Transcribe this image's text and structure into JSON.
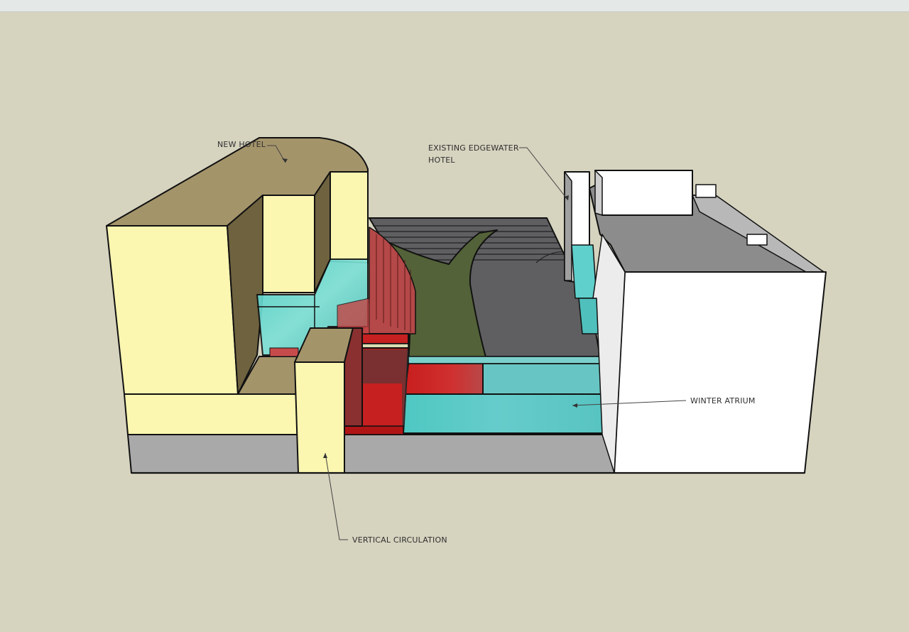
{
  "annotations": {
    "new_hotel": "NEW HOTEL",
    "existing_hotel_line1": "EXISTING EDGEWATER",
    "existing_hotel_line2": "HOTEL",
    "winter_atrium": "WINTER ATRIUM",
    "vertical_circulation": "VERTICAL CIRCULATION"
  },
  "colors": {
    "background": "#d6d3bf",
    "new_hotel_roof": "#a4946a",
    "new_hotel_wall": "#fbf6b0",
    "new_hotel_shade": "#6e623f",
    "glass": "#5fd6d0",
    "red_glazing": "#c62020",
    "green_roof": "#536238",
    "dark_deck": "#5f5f62",
    "podium": "#a9a9a9",
    "existing_hotel": "#ffffff",
    "existing_hotel_roof": "#8c8c8c"
  }
}
